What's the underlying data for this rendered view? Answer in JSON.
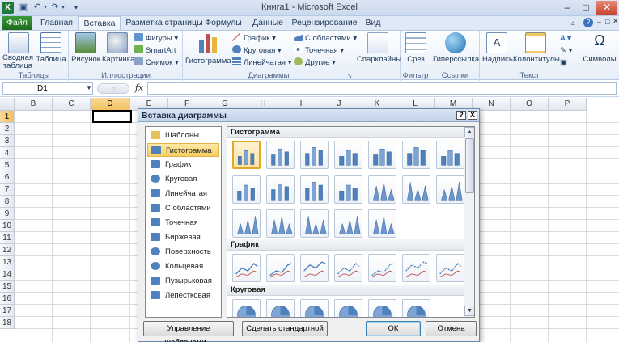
{
  "title": "Книга1 - Microsoft Excel",
  "quick_access": [
    "save-icon",
    "undo-icon",
    "redo-icon"
  ],
  "tabs": [
    {
      "label": "Файл"
    },
    {
      "label": "Главная"
    },
    {
      "label": "Вставка"
    },
    {
      "label": "Разметка страницы"
    },
    {
      "label": "Формулы"
    },
    {
      "label": "Данные"
    },
    {
      "label": "Рецензирование"
    },
    {
      "label": "Вид"
    }
  ],
  "ribbon": {
    "tables": {
      "label": "Таблицы",
      "pivot": "Сводная таблица",
      "table": "Таблица"
    },
    "illustrations": {
      "label": "Иллюстрации",
      "picture": "Рисунок",
      "clipart": "Картинка",
      "shapes": "Фигуры",
      "smartart": "SmartArt",
      "screenshot": "Снимок"
    },
    "charts": {
      "label": "Диаграммы",
      "histogram": "Гистограмма",
      "graph": "График",
      "pie": "Круговая",
      "bar": "Линейчатая",
      "area": "С областями",
      "scatter": "Точечная",
      "other": "Другие"
    },
    "sparklines": {
      "label": "",
      "name": "Спарклайны"
    },
    "filter": {
      "label": "Фильтр",
      "slicer": "Срез"
    },
    "links": {
      "label": "Ссылки",
      "hyperlink": "Гиперссылка"
    },
    "text": {
      "label": "Текст",
      "textbox": "Надпись",
      "headerfooter": "Колонтитулы"
    },
    "symbols": {
      "name": "Символы"
    }
  },
  "namebox": "D1",
  "fx": "fx",
  "columns": [
    "B",
    "C",
    "D",
    "E",
    "F",
    "G",
    "H",
    "I",
    "J",
    "K",
    "L",
    "M",
    "N",
    "O",
    "P"
  ],
  "rows": [
    "1",
    "2",
    "3",
    "4",
    "5",
    "6",
    "7",
    "8",
    "9",
    "10",
    "11",
    "12",
    "13",
    "14",
    "15",
    "16",
    "17",
    "18"
  ],
  "dialog": {
    "title": "Вставка диаграммы",
    "help": "?",
    "close": "X",
    "categories": [
      "Шаблоны",
      "Гистограмма",
      "График",
      "Круговая",
      "Линейчатая",
      "С областями",
      "Точечная",
      "Биржевая",
      "Поверхность",
      "Кольцевая",
      "Пузырьковая",
      "Лепестковая"
    ],
    "selected_category": "Гистограмма",
    "sections": [
      "Гистограмма",
      "График",
      "Круговая"
    ],
    "manage_templates": "Управление шаблонами...",
    "set_default": "Сделать стандартной",
    "ok": "ОК",
    "cancel": "Отмена"
  },
  "colors": {
    "accent": "#4f81bd",
    "selection": "#f7cf62",
    "file_tab": "#2a7a2a"
  }
}
